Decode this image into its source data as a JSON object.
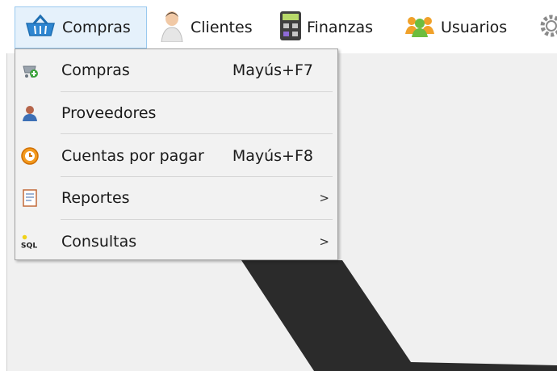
{
  "menubar": {
    "items": [
      {
        "label": "Compras",
        "icon": "basket-icon"
      },
      {
        "label": "Clientes",
        "icon": "person-icon"
      },
      {
        "label": "Finanzas",
        "icon": "calculator-icon"
      },
      {
        "label": "Usuarios",
        "icon": "users-icon"
      }
    ]
  },
  "dropdown": {
    "items": [
      {
        "label": "Compras",
        "shortcut": "Mayús+F7",
        "icon": "cart-add-icon"
      },
      {
        "label": "Proveedores",
        "shortcut": "",
        "icon": "supplier-icon"
      },
      {
        "label": "Cuentas por pagar",
        "shortcut": "Mayús+F8",
        "icon": "clock-icon"
      },
      {
        "label": "Reportes",
        "shortcut": "",
        "arrow": ">",
        "icon": "report-icon"
      },
      {
        "label": "Consultas",
        "shortcut": "",
        "arrow": ">",
        "icon": "sql-icon",
        "icon_text": "SQL"
      }
    ]
  },
  "colors": {
    "menubar_active_bg": "#e5f1fb",
    "menubar_active_border": "#99c9ef",
    "dropdown_bg": "#f2f2f2",
    "workspace_bg": "#f0f0f0",
    "stripe": "#2b2b2b"
  }
}
